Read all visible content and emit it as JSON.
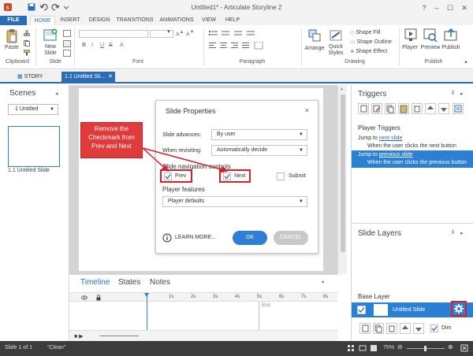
{
  "window": {
    "title": "Untitled1* - Articulate Storyline 2"
  },
  "ribbon_tabs": [
    "FILE",
    "HOME",
    "INSERT",
    "DESIGN",
    "TRANSITIONS",
    "ANIMATIONS",
    "VIEW",
    "HELP"
  ],
  "ribbon": {
    "paste_label": "Paste",
    "new_slide_label": "New Slide",
    "arrange_label": "Arrange",
    "quick_styles_label": "Quick Styles",
    "shape_fill": "Shape Fill",
    "shape_outline": "Shape Outline",
    "shape_effect": "Shape Effect",
    "player_label": "Player",
    "preview_label": "Preview",
    "publish_label": "Publish",
    "groups": {
      "clipboard": "Clipboard",
      "slide": "Slide",
      "font": "Font",
      "paragraph": "Paragraph",
      "drawing": "Drawing",
      "publish": "Publish"
    }
  },
  "doc_tabs": {
    "story_view": "STORY VIEW",
    "slide_tab": "1.1 Untitled Sli..."
  },
  "scenes": {
    "title": "Scenes",
    "selected": "1 Untitled",
    "slide_label": "1.1 Untitled Slide"
  },
  "dialog": {
    "title": "Slide Properties",
    "slide_advances_label": "Slide advances:",
    "slide_advances_value": "By user",
    "when_revisiting_label": "When revisiting:",
    "when_revisiting_value": "Automatically decide",
    "nav_controls_label": "Slide navigation controls",
    "prev_label": "Prev",
    "next_label": "Next",
    "submit_label": "Submit",
    "prev_checked": true,
    "next_checked": true,
    "submit_checked": false,
    "player_features_label": "Player features",
    "player_features_value": "Player defaults",
    "learn_more": "LEARN MORE...",
    "ok": "OK",
    "cancel": "CANCEL"
  },
  "callout": {
    "text": "Remove the Checkmark from Prev and Next"
  },
  "timeline": {
    "tabs": [
      "Timeline",
      "States",
      "Notes"
    ],
    "ticks": [
      "1s",
      "2s",
      "3s",
      "4s",
      "5s",
      "6s",
      "7s",
      "8s"
    ],
    "end_label": "End"
  },
  "triggers": {
    "title": "Triggers",
    "section": "Player Triggers",
    "items": [
      {
        "prefix": "Jump to ",
        "link": "next slide",
        "sub": "When the user clicks the next button"
      },
      {
        "prefix": "Jump to ",
        "link": "previous slide",
        "sub": "When the user clicks the previous button"
      }
    ]
  },
  "layers": {
    "title": "Slide Layers",
    "base_layer": "Base Layer",
    "untitled_slide": "Untitled Slide",
    "dim_label": "Dim"
  },
  "status": {
    "slide_count": "Slide 1 of 1",
    "theme": "\"Clean\"",
    "zoom": "75%"
  },
  "colors": {
    "accent": "#2b6cb6",
    "highlight": "#d8202a",
    "selected_row": "#2b7fd4"
  }
}
